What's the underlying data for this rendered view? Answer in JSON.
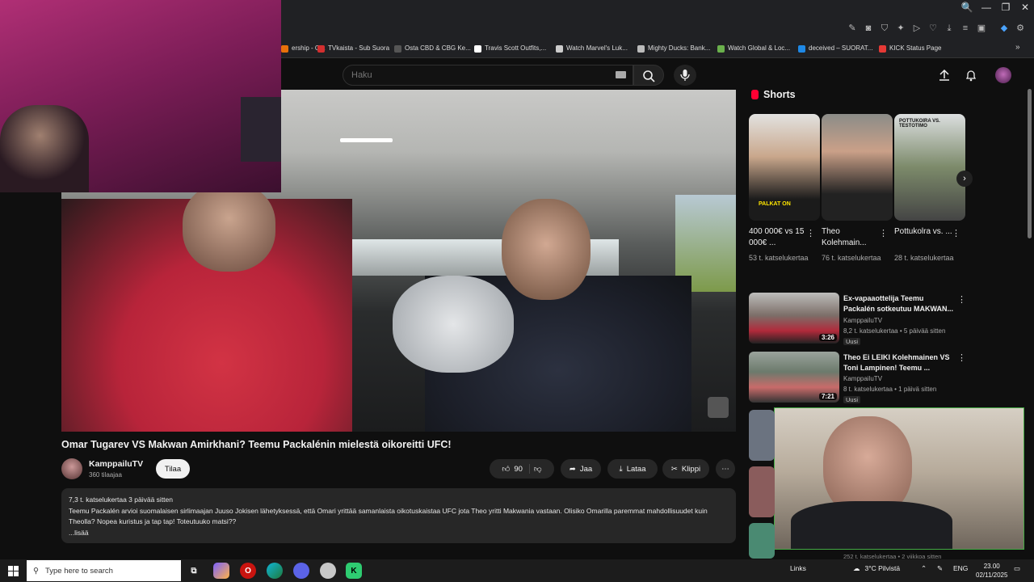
{
  "browser": {
    "window_controls": [
      "🔍",
      "—",
      "❐",
      "✕"
    ],
    "bookmarks": [
      {
        "label": "ership - G...",
        "color": "#e8710a"
      },
      {
        "label": "TVkaista - Sub Suora",
        "color": "#d32f2f"
      },
      {
        "label": "Osta CBD & CBG Ke...",
        "color": "#555555"
      },
      {
        "label": "Travis Scott Outfits,...",
        "color": "#ffffff"
      },
      {
        "label": "Watch Marvel's Luk...",
        "color": "#cccccc"
      },
      {
        "label": "Mighty Ducks: Bank...",
        "color": "#bbbbbb"
      },
      {
        "label": "Watch Global & Loc...",
        "color": "#6ab04c"
      },
      {
        "label": "deceived – SUORAT...",
        "color": "#1e88e5"
      },
      {
        "label": "KICK Status Page",
        "color": "#e53935"
      }
    ]
  },
  "youtube": {
    "search_placeholder": "Haku",
    "video_title": "Omar Tugarev VS Makwan Amirkhani? Teemu Packalénin mielestä oikoreitti UFC!",
    "channel": {
      "name": "KamppailuTV",
      "subs": "360 tilaajaa",
      "subscribe": "Tilaa"
    },
    "actions": {
      "likes": "90",
      "share": "Jaa",
      "download": "Lataa",
      "clip": "Klippi"
    },
    "description": {
      "stats": "7,3 t. katselukertaa  3 päivää sitten",
      "text": "Teemu Packalén arvioi suomalaisen sirlimaajan Juuso Jokisen lähetyksessä, että Omari yrittää samanlaista oikotuskaistaa UFC jota Theo yritti Makwania vastaan. Olisiko Omarilla paremmat mahdollisuudet kuin Theolla? Nopea kuristus ja tap tap! Toteutuuko matsi??",
      "more": "...lisää"
    },
    "shorts_heading": "Shorts",
    "shorts": [
      {
        "title": "400 000€ vs 15 000€ ...",
        "views": "53 t. katselukertaa",
        "overlay": "PALKAT ON"
      },
      {
        "title": "Theo Kolehmain...",
        "views": "76 t. katselukertaa",
        "overlay": ""
      },
      {
        "title": "Pottukolra vs. ...",
        "views": "28 t. katselukertaa",
        "overlay": "POTTUKOIRA VS. TESTOTIMO"
      }
    ],
    "related": [
      {
        "title": "Ex-vapaaottelija Teemu Packalén sotkeutuu MAKWAN...",
        "channel": "KamppailuTV",
        "meta": "8,2 t. katselukertaa • 5 päivää sitten",
        "badge": "Uusi",
        "duration": "3:26"
      },
      {
        "title": "Theo Ei LEIKI Kolehmainen VS Toni Lampinen! Teemu ...",
        "channel": "KamppailuTV",
        "meta": "8 t. katselukertaa • 1 päivä sitten",
        "badge": "Uusi",
        "duration": "7:21"
      }
    ],
    "partial_bottom": "252 t. katselukertaa • 2 viikkoa sitten"
  },
  "taskbar": {
    "search_placeholder": "Type here to search",
    "links": "Links",
    "weather": "3°C  Pilvistä",
    "lang": "ENG",
    "time": "23.00",
    "date": "02/11/2025"
  }
}
